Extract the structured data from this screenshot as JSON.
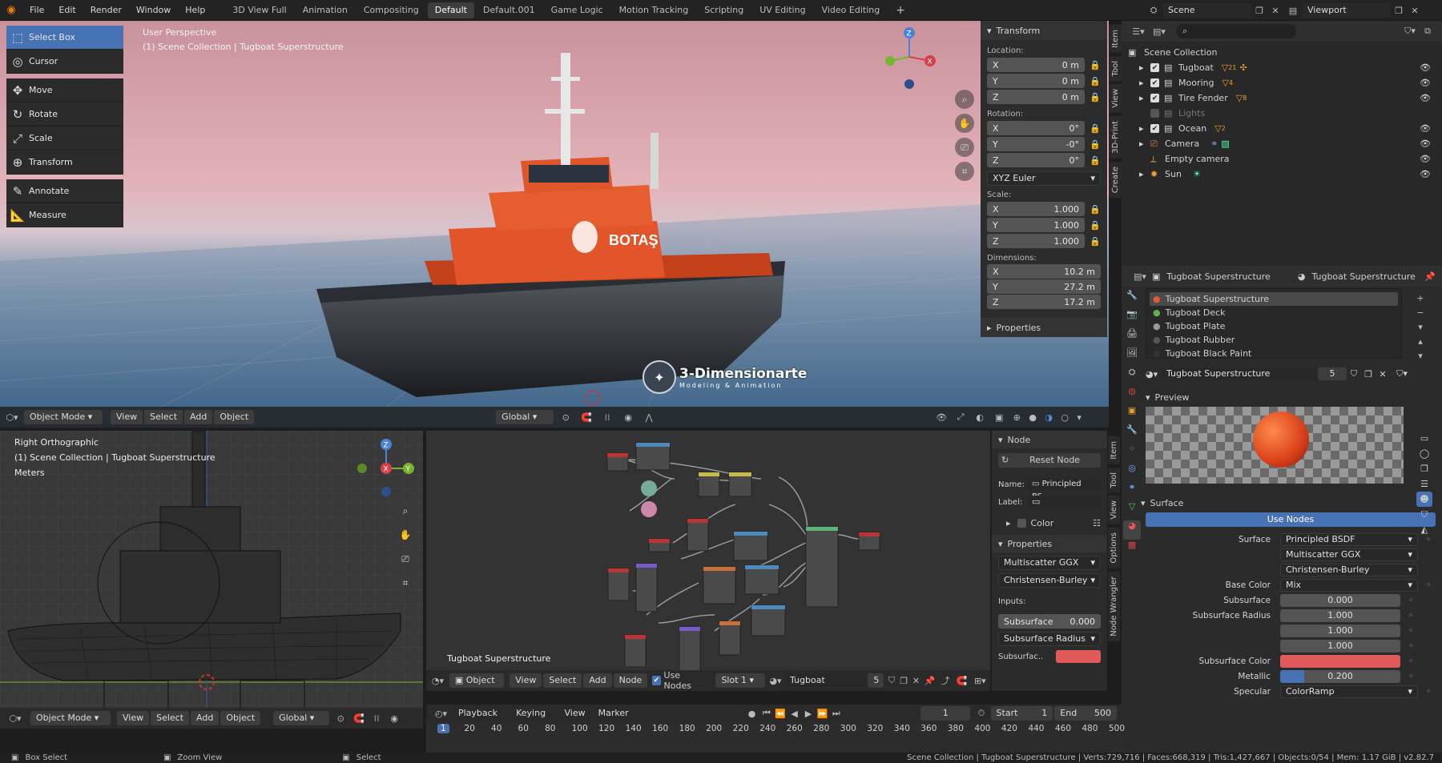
{
  "menubar": {
    "items": [
      "File",
      "Edit",
      "Render",
      "Window",
      "Help"
    ]
  },
  "workspace_tabs": {
    "items": [
      "3D View Full",
      "Animation",
      "Compositing",
      "Default",
      "Default.001",
      "Game Logic",
      "Motion Tracking",
      "Scripting",
      "UV Editing",
      "Video Editing"
    ],
    "active": "Default"
  },
  "scene": {
    "label": "Scene",
    "viewlayer": "Viewport"
  },
  "viewport": {
    "perspective": "User Perspective",
    "collection": "(1) Scene Collection | Tugboat Superstructure",
    "tools": [
      "Select Box",
      "Cursor",
      "Move",
      "Rotate",
      "Scale",
      "Transform",
      "Annotate",
      "Measure"
    ],
    "header": {
      "mode": "Object Mode",
      "menus": [
        "View",
        "Select",
        "Add",
        "Object"
      ],
      "orientation": "Global"
    },
    "watermark": "3-Dimensionarte",
    "watermark_sub": "Modeling & Animation"
  },
  "npanel": {
    "title": "Transform",
    "location_label": "Location:",
    "location": [
      {
        "axis": "X",
        "value": "0 m"
      },
      {
        "axis": "Y",
        "value": "0 m"
      },
      {
        "axis": "Z",
        "value": "0 m"
      }
    ],
    "rotation_label": "Rotation:",
    "rotation": [
      {
        "axis": "X",
        "value": "0°"
      },
      {
        "axis": "Y",
        "value": "-0°"
      },
      {
        "axis": "Z",
        "value": "0°"
      }
    ],
    "rotation_mode": "XYZ Euler",
    "scale_label": "Scale:",
    "scale": [
      {
        "axis": "X",
        "value": "1.000"
      },
      {
        "axis": "Y",
        "value": "1.000"
      },
      {
        "axis": "Z",
        "value": "1.000"
      }
    ],
    "dimensions_label": "Dimensions:",
    "dimensions": [
      {
        "axis": "X",
        "value": "10.2 m"
      },
      {
        "axis": "Y",
        "value": "27.2 m"
      },
      {
        "axis": "Z",
        "value": "17.2 m"
      }
    ],
    "properties": "Properties",
    "tabs": [
      "Item",
      "Tool",
      "View",
      "3D-Print",
      "Create"
    ]
  },
  "outliner": {
    "root": "Scene Collection",
    "items": [
      {
        "name": "Tugboat",
        "checked": true,
        "badge": "21"
      },
      {
        "name": "Mooring",
        "checked": true,
        "badge": "4"
      },
      {
        "name": "Tire Fender",
        "checked": true,
        "badge": "8"
      },
      {
        "name": "Lights",
        "checked": false,
        "badge": ""
      },
      {
        "name": "Ocean",
        "checked": true,
        "badge": "2"
      },
      {
        "name": "Camera",
        "checked": null,
        "badge": ""
      },
      {
        "name": "Empty camera",
        "checked": null,
        "badge": ""
      },
      {
        "name": "Sun",
        "checked": null,
        "badge": ""
      }
    ]
  },
  "properties": {
    "object": "Tugboat Superstructure",
    "material_header": "Tugboat Superstructure",
    "materials": [
      "Tugboat Superstructure",
      "Tugboat Deck",
      "Tugboat Plate",
      "Tugboat Rubber",
      "Tugboat Black Paint"
    ],
    "slot_name": "Tugboat Superstructure",
    "users": "5",
    "preview_label": "Preview",
    "surface_label": "Surface",
    "use_nodes": "Use Nodes",
    "rows": [
      {
        "label": "Surface",
        "value": "Principled BSDF",
        "kind": "drop"
      },
      {
        "label": "",
        "value": "Multiscatter GGX",
        "kind": "drop"
      },
      {
        "label": "",
        "value": "Christensen-Burley",
        "kind": "drop"
      },
      {
        "label": "Base Color",
        "value": "Mix",
        "kind": "drop"
      },
      {
        "label": "Subsurface",
        "value": "0.000",
        "kind": "num"
      },
      {
        "label": "Subsurface Radius",
        "value": "1.000",
        "kind": "num"
      },
      {
        "label": "",
        "value": "1.000",
        "kind": "num"
      },
      {
        "label": "",
        "value": "1.000",
        "kind": "num"
      },
      {
        "label": "Subsurface Color",
        "value": "",
        "kind": "color"
      },
      {
        "label": "Metallic",
        "value": "0.200",
        "kind": "bar"
      },
      {
        "label": "Specular",
        "value": "ColorRamp",
        "kind": "drop"
      }
    ]
  },
  "wire": {
    "view": "Right Orthographic",
    "collection": "(1) Scene Collection | Tugboat Superstructure",
    "units": "Meters",
    "header": {
      "mode": "Object Mode",
      "menus": [
        "View",
        "Select",
        "Add",
        "Object"
      ],
      "orientation": "Global"
    }
  },
  "nodes": {
    "material_label": "Tugboat Superstructure",
    "header": {
      "object": "Object",
      "menus": [
        "View",
        "Select",
        "Add",
        "Node"
      ],
      "use_nodes": "Use Nodes",
      "slot": "Slot 1",
      "material": "Tugboat Superstruct...",
      "users": "5"
    }
  },
  "nodepanel": {
    "title": "Node",
    "reset": "Reset Node",
    "name_label": "Name:",
    "name_value": "Principled BS...",
    "label_label": "Label:",
    "color": "Color",
    "properties": "Properties",
    "dist": "Multiscatter GGX",
    "sss": "Christensen-Burley",
    "inputs": "Inputs:",
    "subsurface": "Subsurface",
    "subsurface_val": "0.000",
    "sss_radius": "Subsurface Radius",
    "sss_color": "Subsurfac..",
    "tabs": [
      "Item",
      "Tool",
      "View",
      "Options",
      "Node Wrangler"
    ]
  },
  "timeline": {
    "menus": [
      "Playback",
      "Keying",
      "View",
      "Marker"
    ],
    "current": "1",
    "start_label": "Start",
    "start": "1",
    "end_label": "End",
    "end": "500",
    "ticks": [
      "1",
      "20",
      "40",
      "60",
      "80",
      "100",
      "120",
      "140",
      "160",
      "180",
      "200",
      "220",
      "240",
      "260",
      "280",
      "300",
      "320",
      "340",
      "360",
      "380",
      "400",
      "420",
      "440",
      "460",
      "480",
      "500"
    ]
  },
  "status": {
    "left": [
      "Box Select",
      "Zoom View",
      "Select"
    ],
    "right": "Scene Collection | Tugboat Superstructure | Verts:729,716 | Faces:668,319 | Tris:1,427,667 | Objects:0/54 | Mem: 1.17 GiB | v2.82.7"
  },
  "colors": {
    "accent": "#4772b3",
    "subsurface_color": "#e05a5a",
    "boat_hull": "#e2542a"
  }
}
